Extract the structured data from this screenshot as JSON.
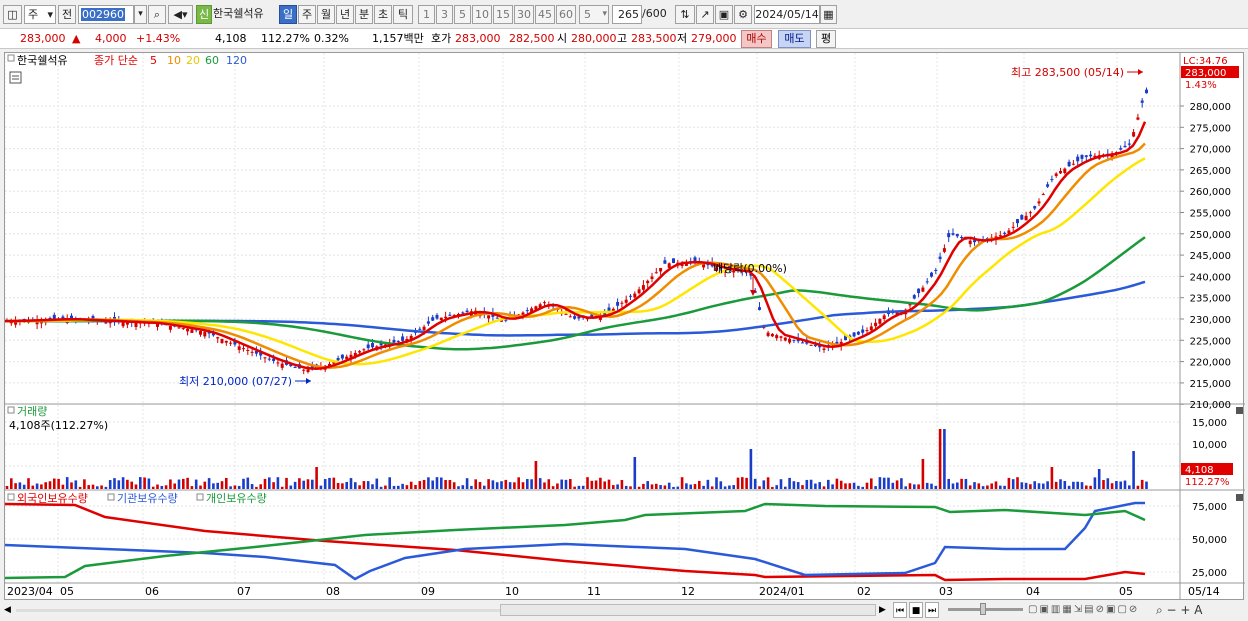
{
  "toolbar": {
    "market_select": "주",
    "prev_label": "전",
    "code_value": "002960",
    "stock_badge": "신",
    "stock_name": "한국쉘석유",
    "periods": [
      "일",
      "주",
      "월",
      "년",
      "분",
      "초",
      "틱"
    ],
    "active_period": "일",
    "intervals": [
      "1",
      "3",
      "5",
      "10",
      "15",
      "30",
      "45",
      "60"
    ],
    "interval_select": "5",
    "count_value": "265",
    "count_total": "/600",
    "date_value": "2024/05/14"
  },
  "quote": {
    "price": "283,000",
    "change": "4,000",
    "change_pct": "+1.43%",
    "volume": "4,108",
    "volume_ratio": "112.27%",
    "turnover": "0.32%",
    "amount": "1,157백만",
    "bid_label": "호가",
    "bid": "283,000",
    "ask": "282,500",
    "open_label": "시",
    "open": "280,000",
    "high_label": "고",
    "high": "283,500",
    "low_label": "저",
    "low": "279,000",
    "buy_label": "매수",
    "sell_label": "매도",
    "eval_label": "평"
  },
  "price_panel": {
    "name": "한국쉘석유",
    "ma_label": "종가 단순",
    "ma_periods": [
      "5",
      "10",
      "20",
      "60",
      "120"
    ],
    "lc_label": "LC:34.76",
    "current_price": "283,000",
    "current_pct": "1.43%",
    "high_annotation": "최고 283,500 (05/14)",
    "low_annotation": "최저 210,000 (07/27)",
    "dividend_annotation": "배당락(0.00%)",
    "y_ticks": [
      "280,000",
      "275,000",
      "270,000",
      "265,000",
      "260,000",
      "255,000",
      "250,000",
      "245,000",
      "240,000",
      "235,000",
      "230,000",
      "225,000",
      "220,000",
      "215,000",
      "210,000"
    ]
  },
  "volume_panel": {
    "title": "거래량",
    "value": "4,108주(112.27%)",
    "y_ticks": [
      "15,000",
      "10,000",
      "5,000"
    ],
    "current": "4,108",
    "current_pct": "112.27%"
  },
  "holding_panel": {
    "series": [
      "외국인보유수량",
      "기관보유수량",
      "개인보유수량"
    ],
    "y_ticks": [
      "75,000",
      "50,000",
      "25,000"
    ]
  },
  "x_axis": {
    "labels": [
      "2023/04",
      "05",
      "06",
      "07",
      "08",
      "09",
      "10",
      "11",
      "12",
      "2024/01",
      "02",
      "03",
      "04",
      "05"
    ],
    "right_label": "05/14"
  },
  "colors": {
    "ma5": "#e00000",
    "ma10": "#f08c00",
    "ma20": "#ffe600",
    "ma60": "#1a9a3a",
    "ma120": "#2a5ad8",
    "up": "#d40000",
    "down": "#1a3cc8"
  },
  "icons": [
    "layout-icon",
    "search-icon",
    "speaker-icon",
    "chart-tools-icon",
    "save-icon",
    "gear-icon",
    "calendar-icon"
  ]
}
